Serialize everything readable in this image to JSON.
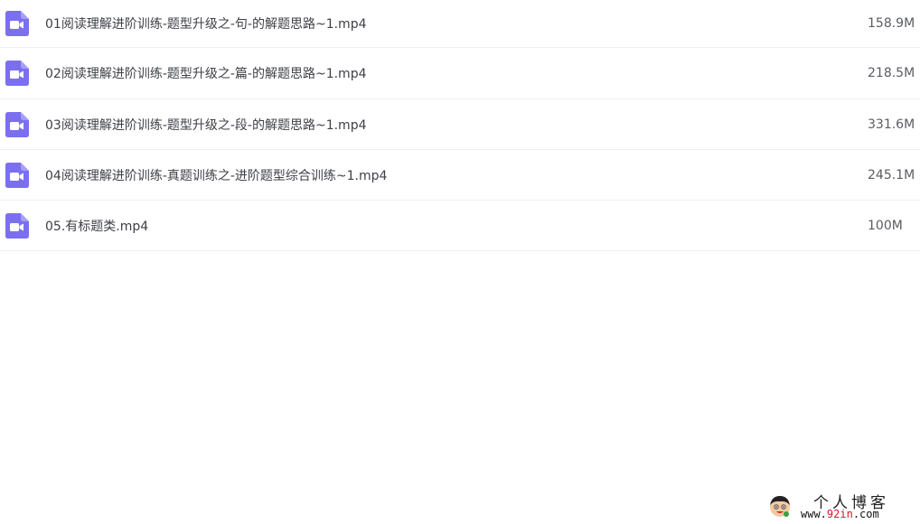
{
  "files": [
    {
      "name": "01阅读理解进阶训练-题型升级之-句-的解题思路~1.mp4",
      "size": "158.9M",
      "icon": "video-file-icon"
    },
    {
      "name": "02阅读理解进阶训练-题型升级之-篇-的解题思路~1.mp4",
      "size": "218.5M",
      "icon": "video-file-icon"
    },
    {
      "name": "03阅读理解进阶训练-题型升级之-段-的解题思路~1.mp4",
      "size": "331.6M",
      "icon": "video-file-icon"
    },
    {
      "name": "04阅读理解进阶训练-真题训练之-进阶题型综合训练~1.mp4",
      "size": "245.1M",
      "icon": "video-file-icon"
    },
    {
      "name": "05.有标题类.mp4",
      "size": "100M",
      "icon": "video-file-icon"
    }
  ],
  "colors": {
    "icon": "#7b6ff0",
    "text": "#3e4046",
    "divider": "#eeeff1",
    "watermark_accent": "#e0112a"
  },
  "watermark": {
    "title": "个人博客",
    "url_prefix": "www.",
    "url_accent": "92in",
    "url_suffix": ".com"
  }
}
